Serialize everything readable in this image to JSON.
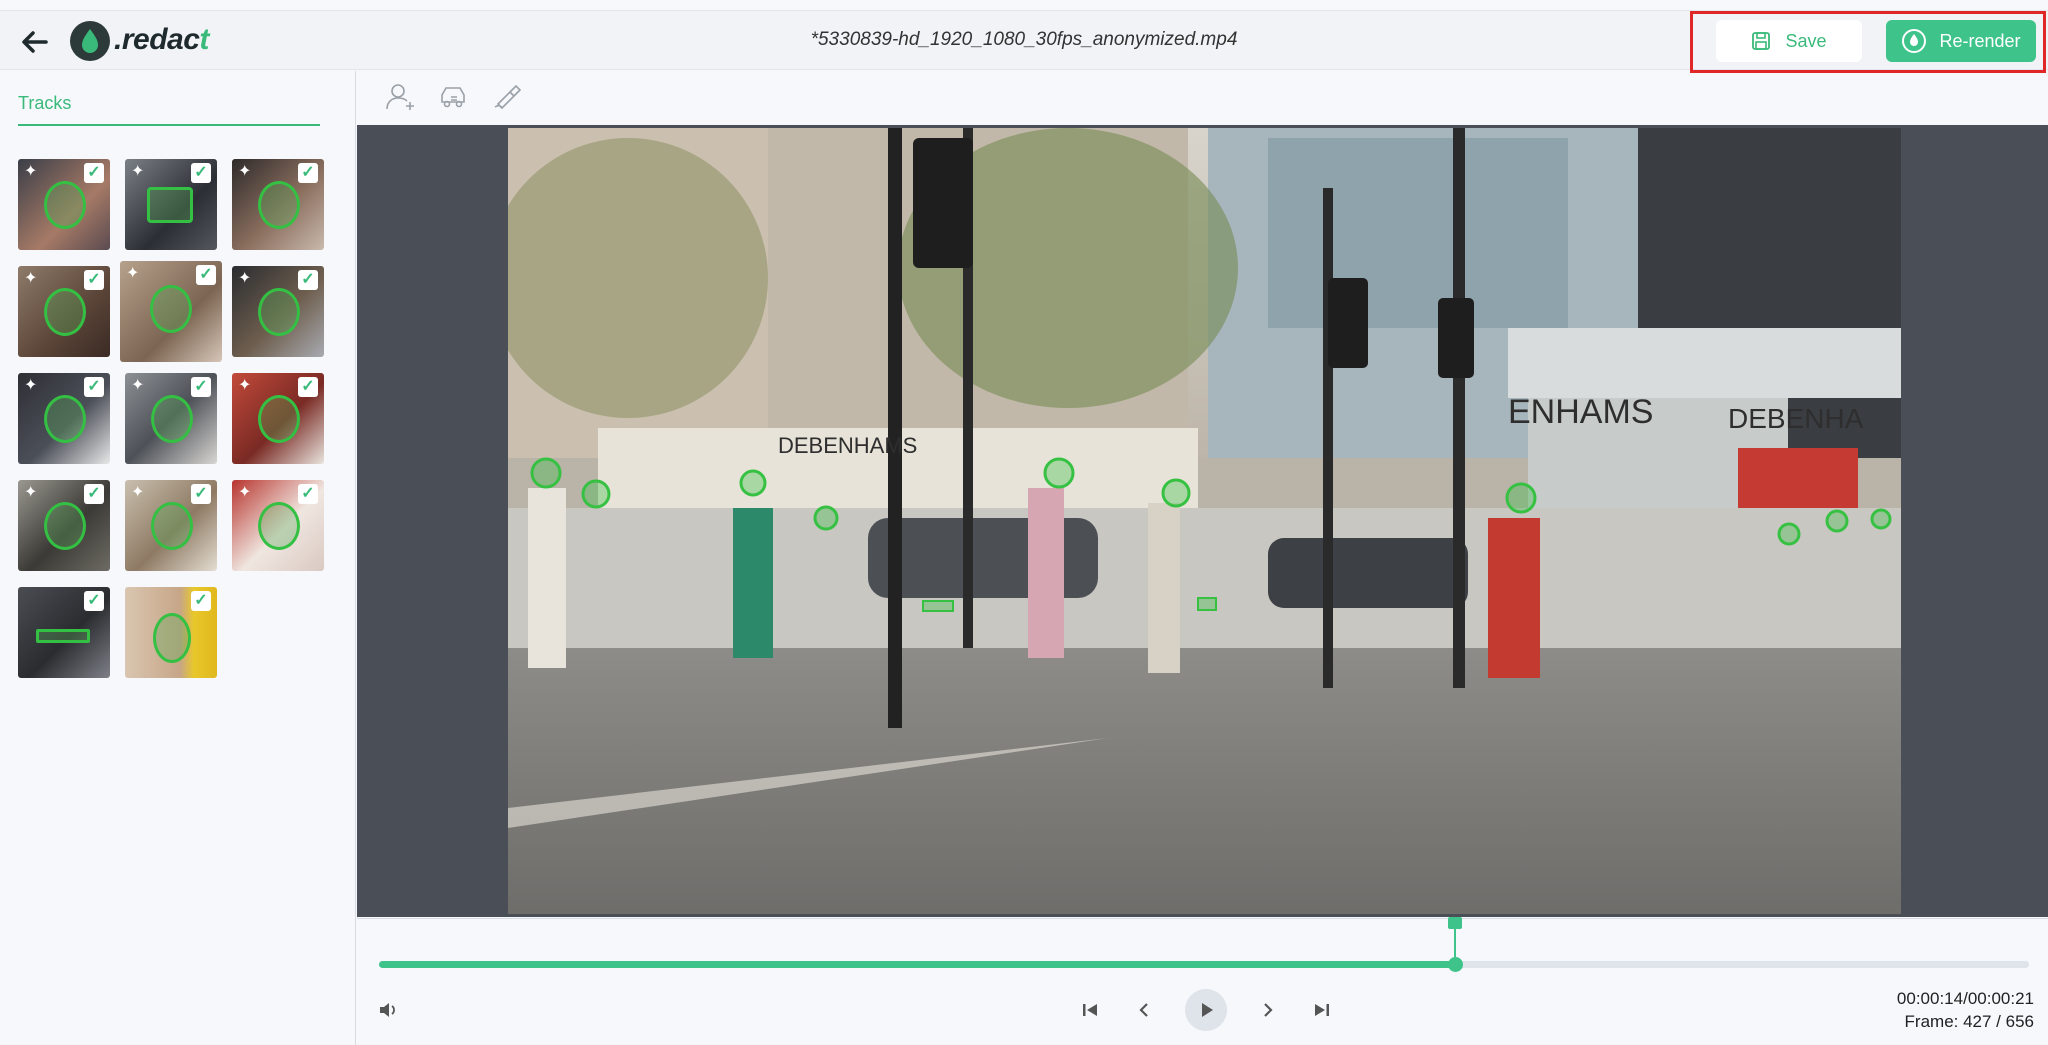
{
  "header": {
    "logo_prefix": ".redac",
    "logo_accent": "t",
    "filename": "*5330839-hd_1920_1080_30fps_anonymized.mp4",
    "save_label": "Save",
    "render_label": "Re-render"
  },
  "sidebar": {
    "title": "Tracks",
    "tracks_count": 14
  },
  "toolbar": {
    "icons": [
      "add-person-icon",
      "add-vehicle-icon",
      "draw-icon"
    ]
  },
  "playback": {
    "progress_fraction": 0.6524,
    "time_label": "00:00:14/00:00:21",
    "frame_label": "Frame: 427 / 656"
  },
  "colors": {
    "accent": "#3aba7a",
    "button": "#3ec48a",
    "highlight_border": "#e02727"
  }
}
